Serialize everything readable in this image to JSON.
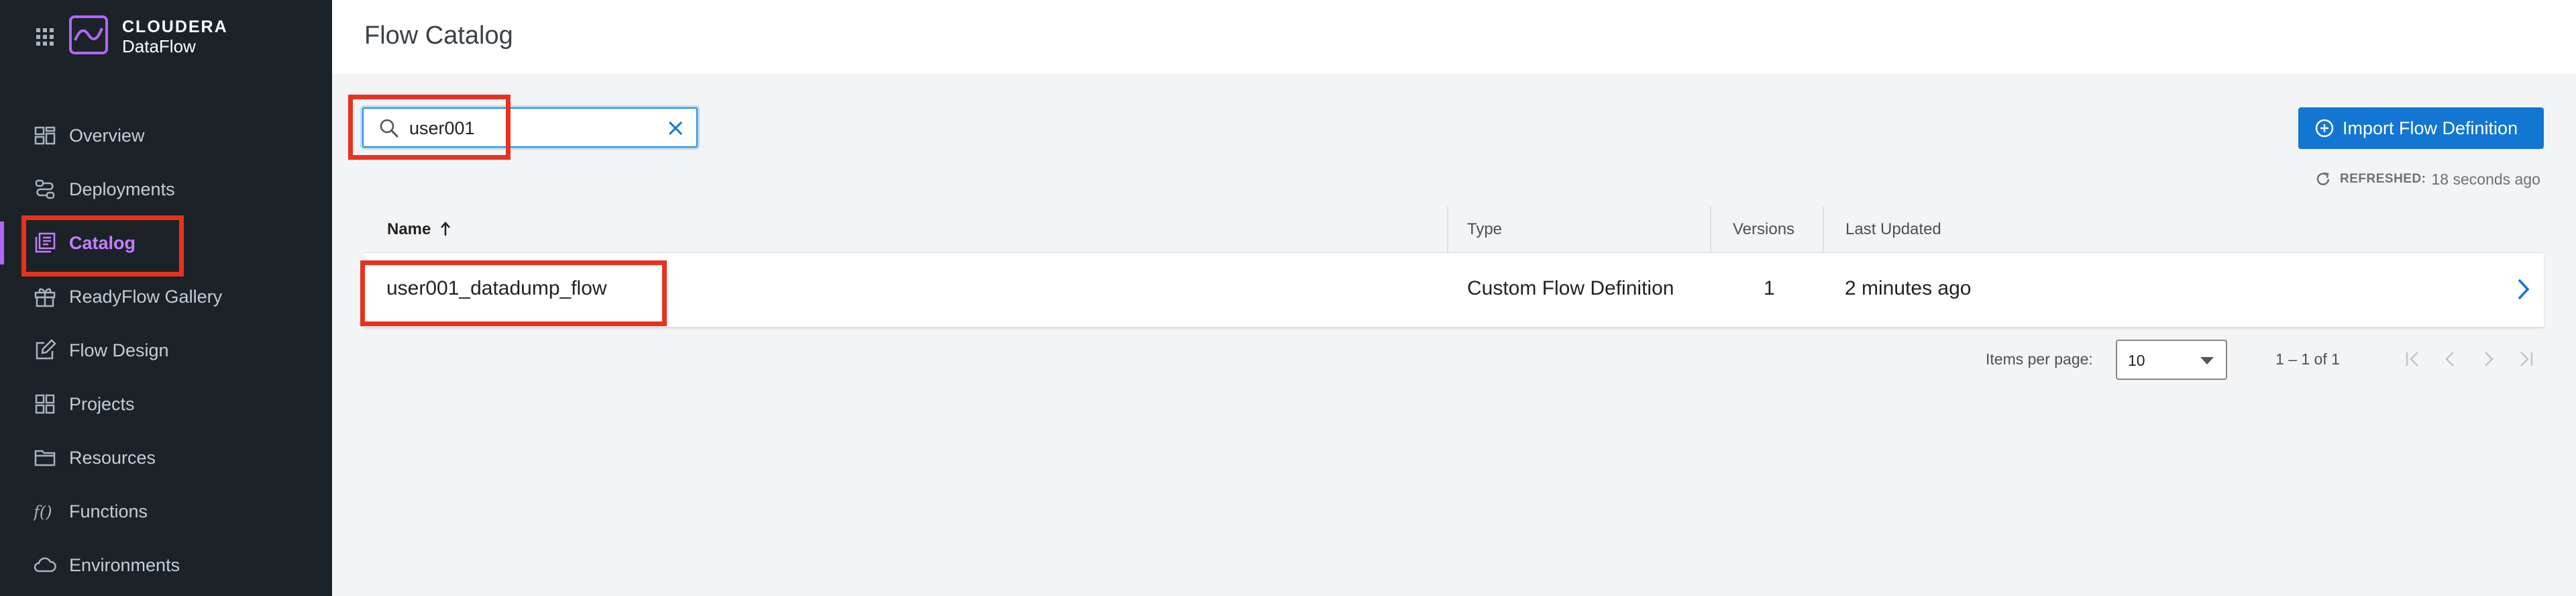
{
  "brand": {
    "name_top": "CLOUDERA",
    "name_bottom": "DataFlow"
  },
  "nav": {
    "items": [
      {
        "label": "Overview",
        "icon": "dashboard-icon"
      },
      {
        "label": "Deployments",
        "icon": "deployments-icon"
      },
      {
        "label": "Catalog",
        "icon": "catalog-icon",
        "active": true
      },
      {
        "label": "ReadyFlow Gallery",
        "icon": "gift-icon"
      },
      {
        "label": "Flow Design",
        "icon": "edit-icon"
      },
      {
        "label": "Projects",
        "icon": "projects-icon"
      },
      {
        "label": "Resources",
        "icon": "folder-icon"
      },
      {
        "label": "Functions",
        "icon": "function-icon"
      },
      {
        "label": "Environments",
        "icon": "cloud-icon"
      }
    ]
  },
  "header": {
    "title": "Flow Catalog"
  },
  "search": {
    "value": "user001"
  },
  "actions": {
    "import_label": "Import Flow Definition"
  },
  "refresh": {
    "label": "REFRESHED:",
    "value": "18 seconds ago"
  },
  "table": {
    "headers": {
      "name": "Name",
      "type": "Type",
      "versions": "Versions",
      "updated": "Last Updated"
    },
    "rows": [
      {
        "name": "user001_datadump_flow",
        "type": "Custom Flow Definition",
        "versions": "1",
        "updated": "2 minutes ago"
      }
    ]
  },
  "pagination": {
    "label": "Items per page:",
    "per_page": "10",
    "range": "1 – 1 of 1"
  },
  "colors": {
    "accent": "#1376d2",
    "sidebar": "#1b2329",
    "active": "#c77dff",
    "highlight": "#e8321e"
  }
}
